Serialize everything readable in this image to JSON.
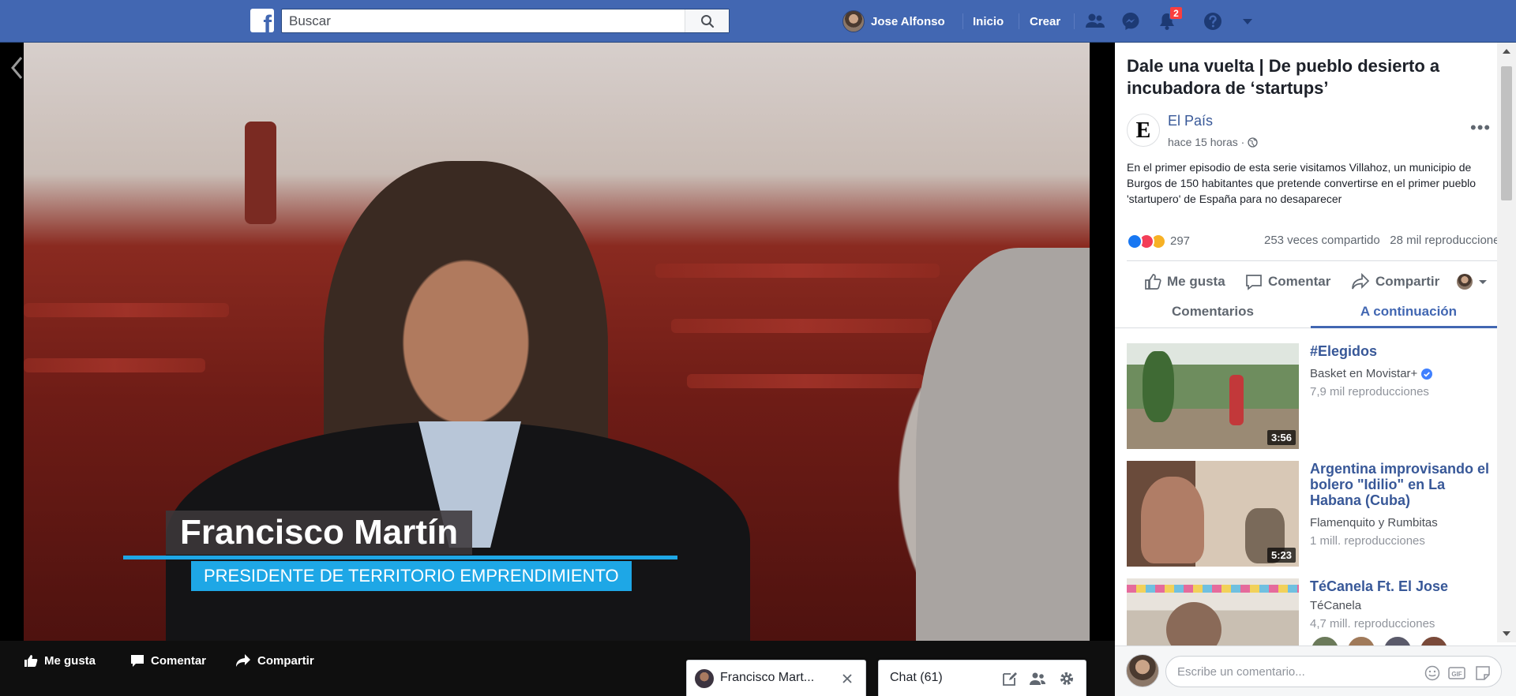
{
  "topbar": {
    "search_placeholder": "Buscar",
    "user_name": "Jose Alfonso",
    "home_label": "Inicio",
    "create_label": "Crear",
    "notifications_count": "2"
  },
  "video": {
    "lower_third_name": "Francisco Martín",
    "lower_third_title": "PRESIDENTE DE TERRITORIO EMPRENDIMIENTO",
    "actions": {
      "like": "Me gusta",
      "comment": "Comentar",
      "share": "Compartir"
    }
  },
  "chat": {
    "conversation_name": "Francisco Mart...",
    "chat_label": "Chat (61)"
  },
  "post": {
    "title": "Dale una vuelta | De pueblo desierto a incubadora de ‘startups’",
    "page_logo_letter": "E",
    "page_name": "El País",
    "time": "hace 15 horas ·",
    "description": "En el primer episodio de esta serie visitamos Villahoz, un municipio de Burgos de 150 habitantes que pretende convertirse en el primer pueblo 'startupero' de España para no desaparecer",
    "reactions_count": "297",
    "shares": "253 veces compartido",
    "views": "28 mil reproducciones",
    "actions": {
      "like": "Me gusta",
      "comment": "Comentar",
      "share": "Compartir"
    },
    "tabs": [
      "Comentarios",
      "A continuación"
    ]
  },
  "suggestions": [
    {
      "title": "#Elegidos",
      "channel": "Basket en Movistar+",
      "verified": true,
      "views": "7,9 mil reproducciones",
      "duration": "3:56"
    },
    {
      "title": "Argentina improvisando el bolero \"Idilio\" en La Habana (Cuba)",
      "channel": "Flamenquito y Rumbitas",
      "verified": false,
      "views": "1 mill. reproducciones",
      "duration": "5:23"
    },
    {
      "title": "TéCanela Ft. El Jose",
      "channel": "TéCanela",
      "verified": false,
      "views": "4,7 mill. reproducciones",
      "duration": ""
    }
  ],
  "comment_box": {
    "placeholder": "Escribe un comentario..."
  },
  "colors": {
    "brand": "#4267b2",
    "link": "#385898",
    "lower_third_accent": "#1ea7e6",
    "badge": "#fa3e3e"
  },
  "icons": [
    "facebook-logo-icon",
    "search-icon",
    "friends-icon",
    "messenger-icon",
    "bell-icon",
    "help-icon",
    "caret-down-icon",
    "back-arrow-icon",
    "like-icon",
    "comment-icon",
    "share-icon",
    "more-dots-icon",
    "globe-icon",
    "verified-icon",
    "close-icon",
    "compose-icon",
    "group-icon",
    "gear-icon",
    "emoji-icon",
    "gif-icon",
    "sticker-icon"
  ]
}
